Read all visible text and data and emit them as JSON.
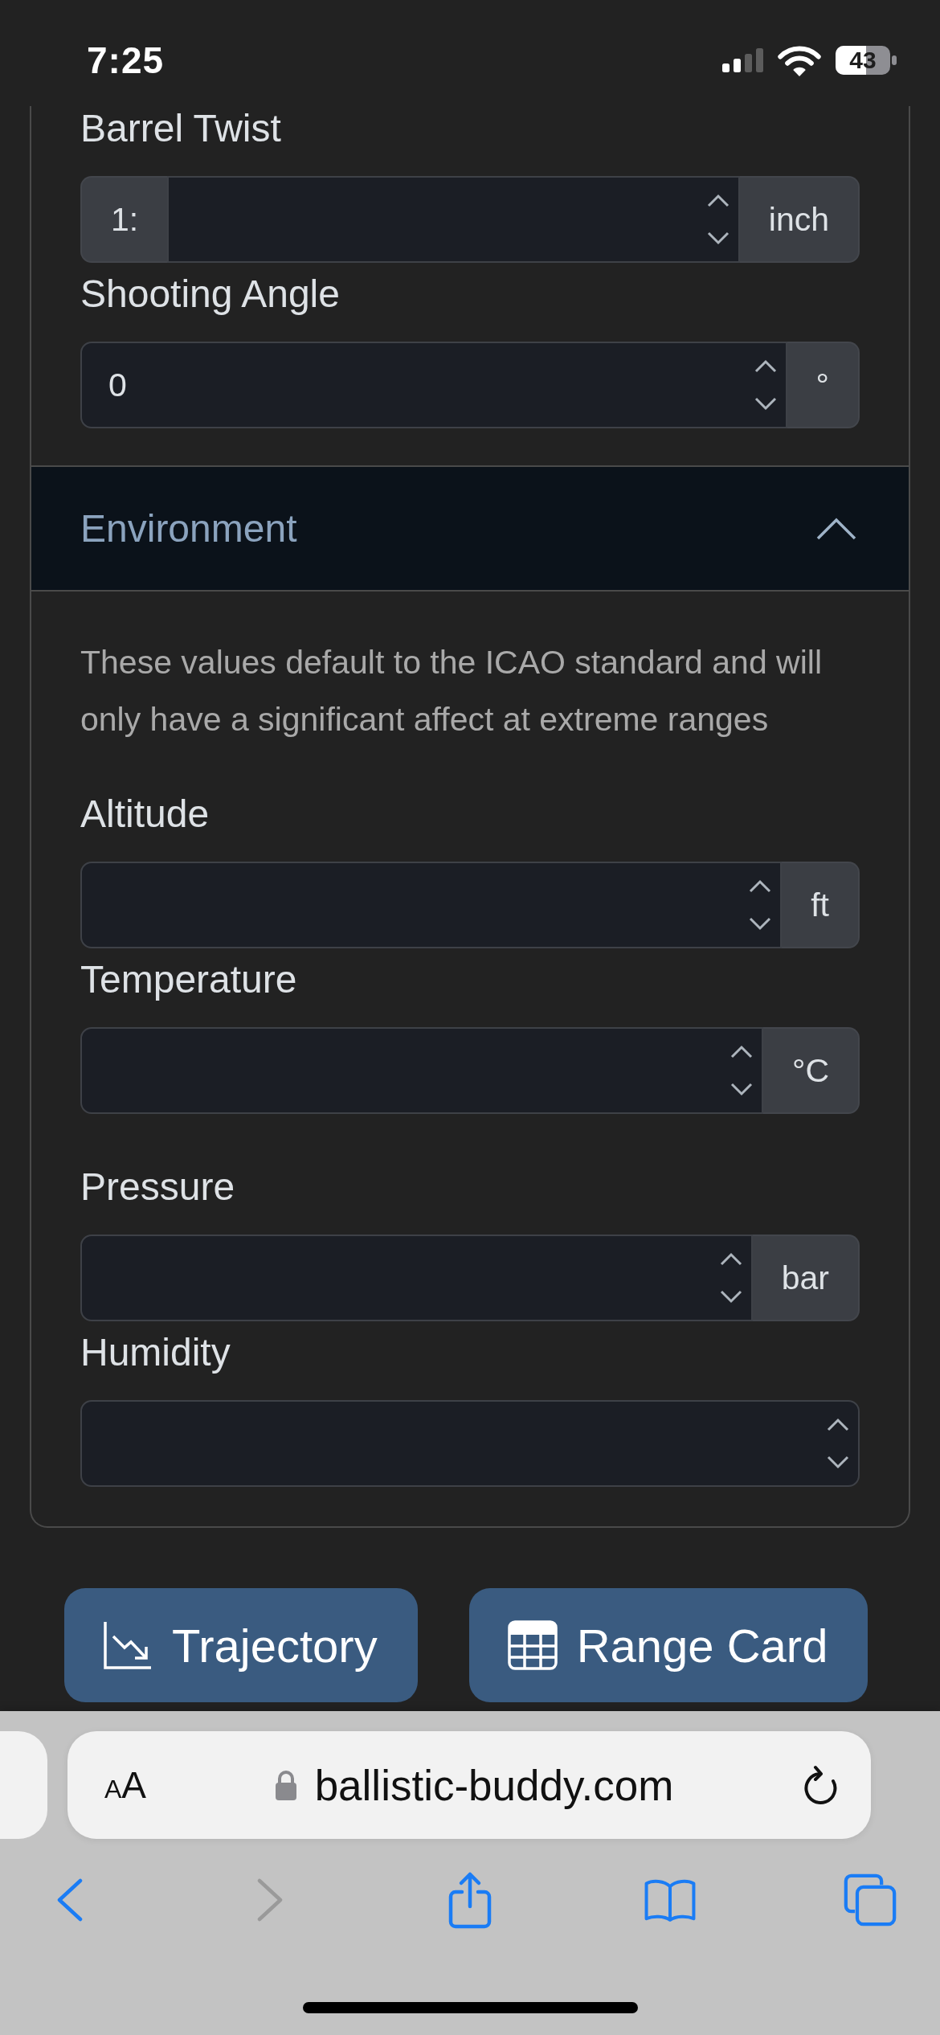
{
  "status_bar": {
    "time": "7:25",
    "battery": "43"
  },
  "ballistics_fields": [
    {
      "label": "Barrel Twist",
      "prefix": "1:",
      "unit": "inch"
    },
    {
      "label": "Shooting Angle",
      "value": "0",
      "unit": "°"
    }
  ],
  "environment": {
    "title": "Environment",
    "expanded": true,
    "note": "These values default to the ICAO standard and will only have a significant affect at extreme ranges",
    "fields": [
      {
        "label": "Altitude",
        "unit": "ft"
      },
      {
        "label": "Temperature",
        "unit": "°C"
      },
      {
        "label": "Pressure",
        "unit": "bar"
      },
      {
        "label": "Humidity"
      }
    ]
  },
  "actions": [
    {
      "label": "Trajectory"
    },
    {
      "label": "Range Card"
    }
  ],
  "browser": {
    "format_button": "AA",
    "address": "ballistic-buddy.com",
    "toolbar": [
      {
        "kind": "back",
        "disabled": false
      },
      {
        "kind": "forward",
        "disabled": true
      },
      {
        "kind": "share",
        "disabled": false
      },
      {
        "kind": "bookmarks",
        "disabled": false
      },
      {
        "kind": "tabs",
        "disabled": false
      }
    ]
  }
}
